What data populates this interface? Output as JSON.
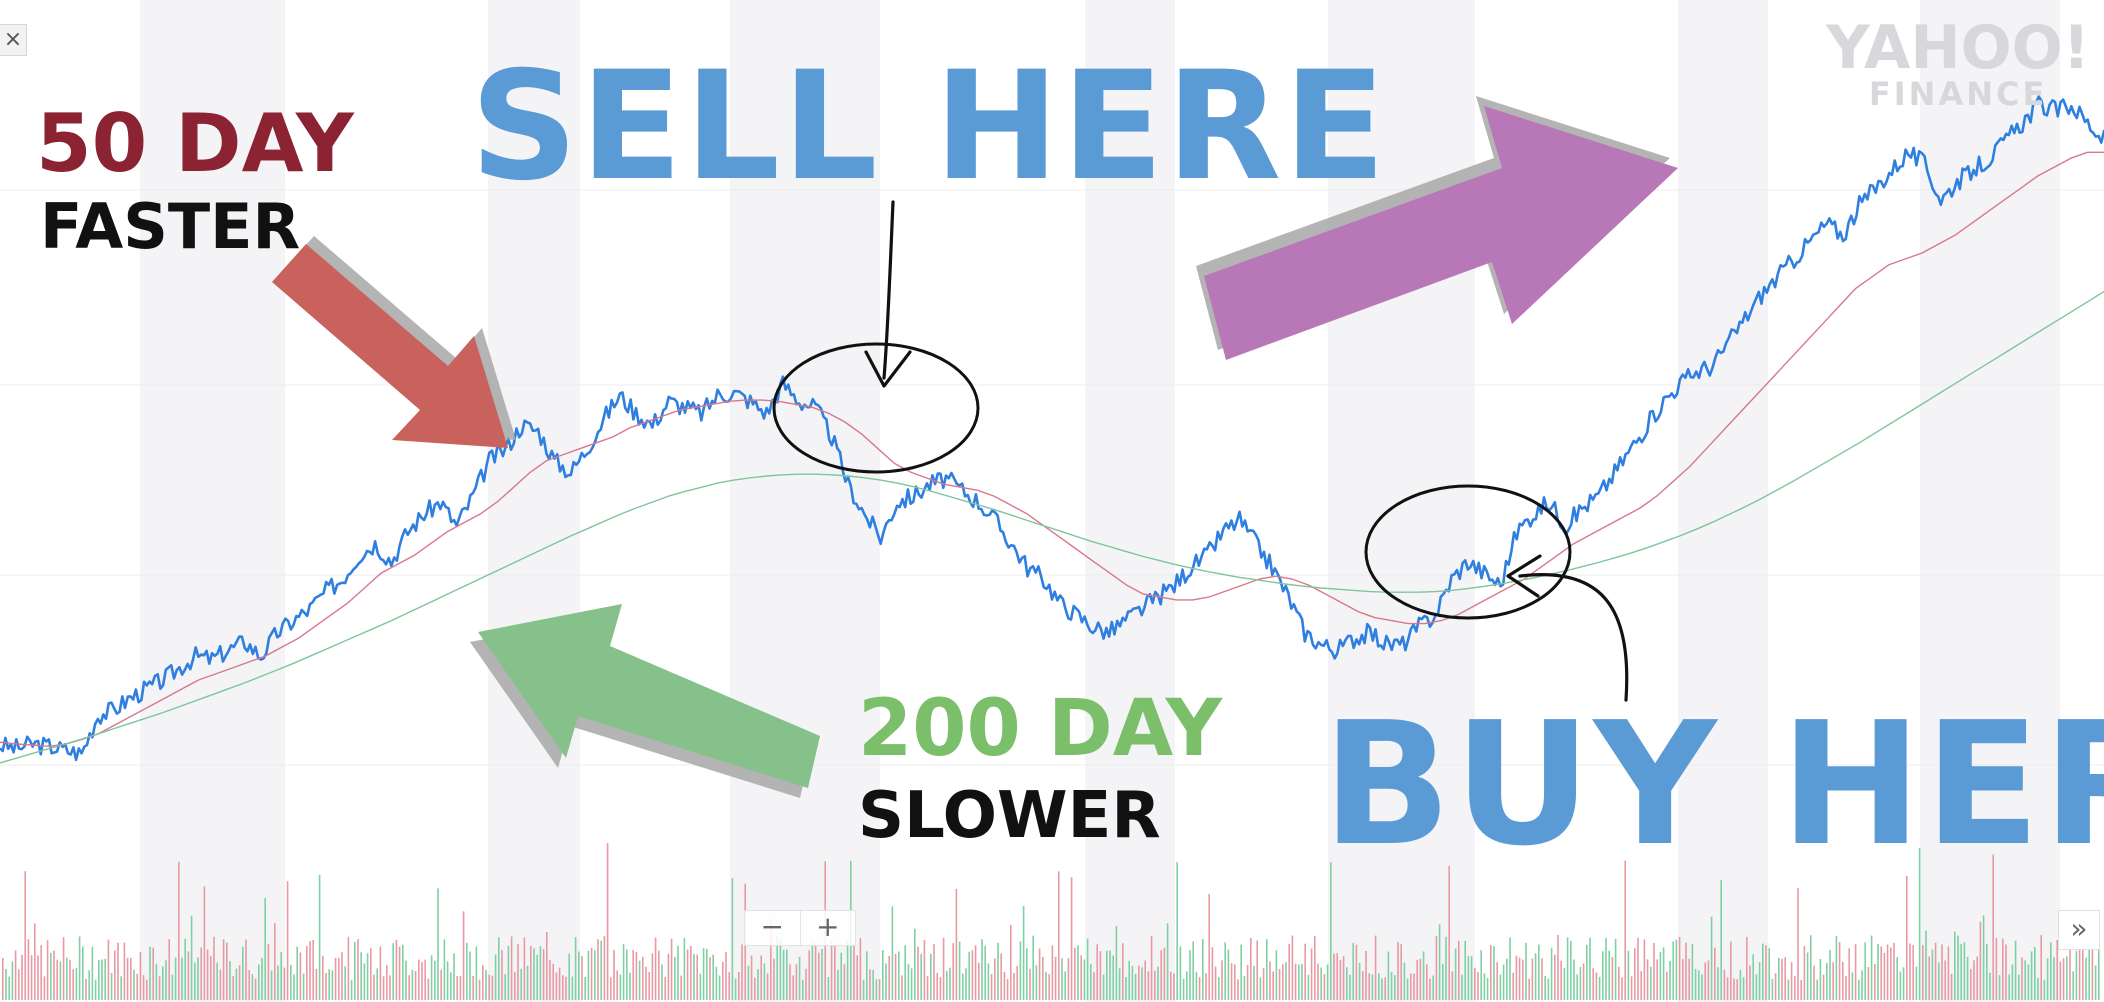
{
  "chart_data": {
    "type": "line",
    "title": "",
    "xlabel": "",
    "ylabel": "",
    "grid": true,
    "series": [
      {
        "key": "price",
        "color": "#2f7fe0",
        "values": [
          16,
          15.5,
          16.2,
          15.8,
          15.2,
          14.6,
          21,
          22,
          24,
          25.5,
          27,
          29,
          31,
          30.5,
          32,
          33.5,
          31,
          35,
          37,
          39,
          42,
          44,
          48,
          50,
          47,
          52,
          55,
          57,
          53,
          58,
          64,
          66,
          70,
          69,
          64,
          62,
          66,
          71,
          75,
          72,
          70,
          74,
          73,
          72,
          75,
          75.5,
          74,
          72,
          77,
          74,
          73,
          68,
          60,
          55,
          51,
          57,
          58,
          60,
          61,
          59,
          57,
          54,
          50,
          46,
          44,
          40,
          38,
          36,
          35,
          37,
          39,
          41,
          43,
          46,
          48,
          52,
          54,
          50,
          46,
          41,
          35,
          33,
          32,
          34,
          35,
          33,
          33,
          36,
          38,
          44,
          47,
          45,
          43,
          52,
          55,
          57,
          53,
          56,
          58,
          62,
          66,
          70,
          74,
          77,
          79,
          80,
          84,
          88,
          92,
          95,
          98,
          101,
          104,
          102,
          107,
          110,
          113,
          116,
          114,
          108,
          111,
          113,
          115,
          118,
          121,
          124,
          123,
          124,
          121,
          118
        ]
      },
      {
        "key": "ma50",
        "color": "#d9788a",
        "values": [
          16.5,
          16.2,
          16.0,
          15.8,
          16.2,
          17,
          18,
          19.5,
          21,
          22.5,
          24,
          25.5,
          27,
          28,
          29,
          30,
          31,
          32.5,
          34,
          36,
          38,
          40,
          42.5,
          45,
          46.5,
          48,
          50,
          52,
          53.5,
          55,
          57,
          59.5,
          62,
          64,
          65,
          66,
          67,
          68,
          69.5,
          70.5,
          71.5,
          72.5,
          73,
          73.5,
          74,
          74.2,
          74.2,
          74,
          73.5,
          73,
          72,
          70.5,
          68.5,
          66,
          63.5,
          62,
          61,
          60,
          59.5,
          59,
          58,
          56.5,
          55,
          53,
          51,
          49,
          47,
          45,
          43,
          41.5,
          41,
          40.5,
          40.5,
          41,
          42,
          43,
          44,
          44.5,
          44,
          43,
          41.5,
          40,
          38.5,
          37.5,
          37,
          36.5,
          36.5,
          37,
          38,
          39.5,
          41,
          42.5,
          44,
          46,
          48,
          50,
          51.5,
          53,
          54.5,
          56,
          58,
          60.5,
          63,
          66,
          69,
          72,
          75,
          78,
          81,
          84,
          87,
          90,
          93,
          95,
          97,
          98,
          99,
          100.5,
          102,
          104,
          106,
          108,
          110,
          112,
          113.5,
          115,
          116,
          116
        ]
      },
      {
        "key": "ma200",
        "color": "#7fc59a",
        "values": [
          13,
          13.8,
          14.6,
          15.4,
          16.2,
          17,
          17.9,
          18.8,
          19.7,
          20.6,
          21.5,
          22.5,
          23.5,
          24.5,
          25.5,
          26.5,
          27.6,
          28.7,
          29.8,
          31,
          32.2,
          33.4,
          34.6,
          35.8,
          37,
          38.3,
          39.6,
          40.9,
          42.2,
          43.5,
          44.8,
          46.1,
          47.4,
          48.7,
          50,
          51.3,
          52.5,
          53.7,
          54.9,
          56,
          57,
          58,
          58.8,
          59.5,
          60.2,
          60.7,
          61.1,
          61.4,
          61.6,
          61.7,
          61.7,
          61.6,
          61.4,
          61.1,
          60.7,
          60.2,
          59.6,
          58.9,
          58.1,
          57.3,
          56.5,
          55.7,
          54.8,
          53.9,
          53,
          52.1,
          51.2,
          50.3,
          49.5,
          48.7,
          47.9,
          47.2,
          46.5,
          45.9,
          45.3,
          44.8,
          44.3,
          43.9,
          43.5,
          43.1,
          42.8,
          42.5,
          42.3,
          42.1,
          41.9,
          41.8,
          41.8,
          41.8,
          41.9,
          42.1,
          42.4,
          42.8,
          43.2,
          43.7,
          44.2,
          44.8,
          45.4,
          46.1,
          46.8,
          47.6,
          48.4,
          49.3,
          50.3,
          51.3,
          52.4,
          53.6,
          54.9,
          56.2,
          57.6,
          59.1,
          60.6,
          62.2,
          63.8,
          65.4,
          67,
          68.7,
          70.4,
          72.1,
          73.8,
          75.5,
          77.2,
          78.9,
          80.6,
          82.3,
          84,
          85.7,
          87.4,
          89.1,
          90.8,
          92.5
        ]
      }
    ],
    "ylim": [
      0,
      140
    ]
  },
  "annotations": {
    "fifty_day": "50 DAY",
    "faster": "FASTER",
    "two_hundred_day": "200 DAY",
    "slower": "SLOWER",
    "sell_here": "SELL HERE",
    "buy_here": "BUY HERE"
  },
  "watermark": {
    "line1": "YAHOO!",
    "line2": "FINANCE"
  },
  "controls": {
    "close": "×",
    "zoom_out": "−",
    "zoom_in": "+",
    "expand": "»"
  },
  "colors": {
    "price": "#2f7fe0",
    "ma50": "#d9788a",
    "ma200": "#7fc59a",
    "sell_buy_text": "#5b9bd5",
    "fifty_day_text": "#8b2332",
    "two_hundred_day_text": "#7bbf6a",
    "arrow_red": "#c9625c",
    "arrow_green": "#86c08a",
    "arrow_purple": "#b878b8",
    "volume_green": "#7fd0a2",
    "volume_red": "#e89aa2"
  }
}
